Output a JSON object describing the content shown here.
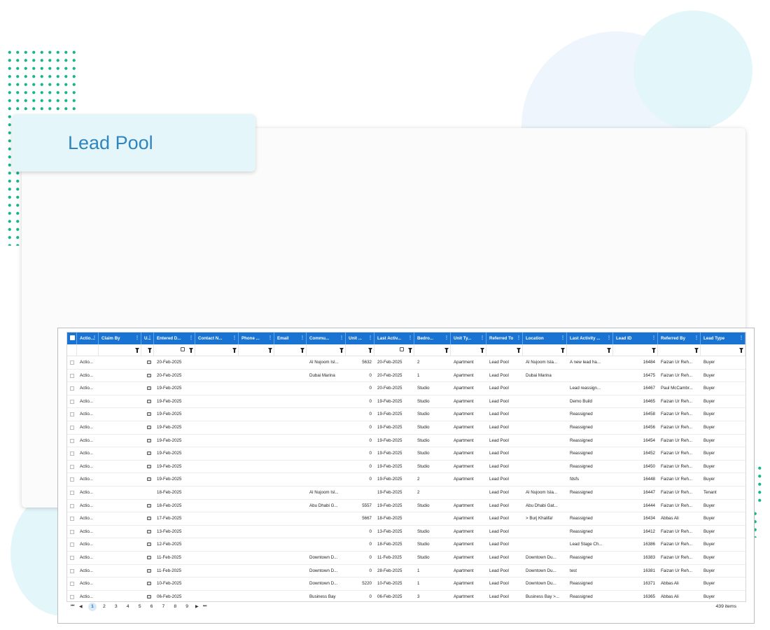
{
  "page": {
    "title": "Lead Pool"
  },
  "colors": {
    "accent": "#1873d3",
    "dots": "#16b58b",
    "title": "#2f86bf"
  },
  "columns": [
    {
      "key": "sel",
      "label": ""
    },
    {
      "key": "action",
      "label": "Actio..."
    },
    {
      "key": "claim_by",
      "label": "Claim By"
    },
    {
      "key": "u",
      "label": "U..."
    },
    {
      "key": "entered",
      "label": "Entered D..."
    },
    {
      "key": "contact",
      "label": "Contact N..."
    },
    {
      "key": "phone",
      "label": "Phone ..."
    },
    {
      "key": "email",
      "label": "Email"
    },
    {
      "key": "community",
      "label": "Commu..."
    },
    {
      "key": "unit",
      "label": "Unit ..."
    },
    {
      "key": "last_activity",
      "label": "Last Activ..."
    },
    {
      "key": "bedrooms",
      "label": "Bedro..."
    },
    {
      "key": "unit_type",
      "label": "Unit Ty..."
    },
    {
      "key": "referred_to",
      "label": "Referred To"
    },
    {
      "key": "location",
      "label": "Location"
    },
    {
      "key": "last_activity_note",
      "label": "Last Activity ..."
    },
    {
      "key": "lead_id",
      "label": "Lead ID"
    },
    {
      "key": "referred_by",
      "label": "Referred By"
    },
    {
      "key": "lead_type",
      "label": "Lead Type"
    }
  ],
  "rows": [
    {
      "action": "Actio...",
      "u": true,
      "entered": "20-Feb-2025",
      "community": "Al Nujoom Isl...",
      "unit": "5632",
      "last_activity": "20-Feb-2025",
      "bedrooms": "2",
      "unit_type": "Apartment",
      "referred_to": "Lead Pool",
      "location": "Al Nujoom Isla...",
      "note": "A new lead ha...",
      "lead_id": "16484",
      "referred_by": "Faizan Ur Reh...",
      "lead_type": "Buyer"
    },
    {
      "action": "Actio...",
      "u": true,
      "entered": "20-Feb-2025",
      "community": "Dubai Marina",
      "unit": "0",
      "last_activity": "20-Feb-2025",
      "bedrooms": "1",
      "unit_type": "Apartment",
      "referred_to": "Lead Pool",
      "location": "Dubai Marina",
      "note": "",
      "lead_id": "16475",
      "referred_by": "Faizan Ur Reh...",
      "lead_type": "Buyer"
    },
    {
      "action": "Actio...",
      "u": true,
      "entered": "19-Feb-2025",
      "community": "",
      "unit": "0",
      "last_activity": "20-Feb-2025",
      "bedrooms": "Studio",
      "unit_type": "Apartment",
      "referred_to": "Lead Pool",
      "location": "",
      "note": "Lead reassign...",
      "lead_id": "16467",
      "referred_by": "Paul McCambr...",
      "lead_type": "Buyer"
    },
    {
      "action": "Actio...",
      "u": true,
      "entered": "19-Feb-2025",
      "community": "",
      "unit": "0",
      "last_activity": "19-Feb-2025",
      "bedrooms": "Studio",
      "unit_type": "Apartment",
      "referred_to": "Lead Pool",
      "location": "",
      "note": "Demo Build",
      "lead_id": "16465",
      "referred_by": "Faizan Ur Reh...",
      "lead_type": "Buyer"
    },
    {
      "action": "Actio...",
      "u": true,
      "entered": "19-Feb-2025",
      "community": "",
      "unit": "0",
      "last_activity": "19-Feb-2025",
      "bedrooms": "Studio",
      "unit_type": "Apartment",
      "referred_to": "Lead Pool",
      "location": "",
      "note": "Reassigned",
      "lead_id": "16458",
      "referred_by": "Faizan Ur Reh...",
      "lead_type": "Buyer"
    },
    {
      "action": "Actio...",
      "u": true,
      "entered": "19-Feb-2025",
      "community": "",
      "unit": "0",
      "last_activity": "19-Feb-2025",
      "bedrooms": "Studio",
      "unit_type": "Apartment",
      "referred_to": "Lead Pool",
      "location": "",
      "note": "Reassigned",
      "lead_id": "16456",
      "referred_by": "Faizan Ur Reh...",
      "lead_type": "Buyer"
    },
    {
      "action": "Actio...",
      "u": true,
      "entered": "19-Feb-2025",
      "community": "",
      "unit": "0",
      "last_activity": "19-Feb-2025",
      "bedrooms": "Studio",
      "unit_type": "Apartment",
      "referred_to": "Lead Pool",
      "location": "",
      "note": "Reassigned",
      "lead_id": "16454",
      "referred_by": "Faizan Ur Reh...",
      "lead_type": "Buyer"
    },
    {
      "action": "Actio...",
      "u": true,
      "entered": "19-Feb-2025",
      "community": "",
      "unit": "0",
      "last_activity": "19-Feb-2025",
      "bedrooms": "Studio",
      "unit_type": "Apartment",
      "referred_to": "Lead Pool",
      "location": "",
      "note": "Reassigned",
      "lead_id": "16452",
      "referred_by": "Faizan Ur Reh...",
      "lead_type": "Buyer"
    },
    {
      "action": "Actio...",
      "u": true,
      "entered": "19-Feb-2025",
      "community": "",
      "unit": "0",
      "last_activity": "19-Feb-2025",
      "bedrooms": "Studio",
      "unit_type": "Apartment",
      "referred_to": "Lead Pool",
      "location": "",
      "note": "Reassigned",
      "lead_id": "16450",
      "referred_by": "Faizan Ur Reh...",
      "lead_type": "Buyer"
    },
    {
      "action": "Actio...",
      "u": true,
      "entered": "19-Feb-2025",
      "community": "",
      "unit": "0",
      "last_activity": "19-Feb-2025",
      "bedrooms": "2",
      "unit_type": "Apartment",
      "referred_to": "Lead Pool",
      "location": "",
      "note": "fdsfs",
      "lead_id": "16448",
      "referred_by": "Faizan Ur Reh...",
      "lead_type": "Buyer"
    },
    {
      "action": "Actio...",
      "u": false,
      "entered": "18-Feb-2025",
      "community": "Al Nujoom Isl...",
      "unit": "",
      "last_activity": "19-Feb-2025",
      "bedrooms": "2",
      "unit_type": "",
      "referred_to": "Lead Pool",
      "location": "Al Nujoom Isla...",
      "note": "Reassigned",
      "lead_id": "16447",
      "referred_by": "Faizan Ur Reh...",
      "lead_type": "Tenant"
    },
    {
      "action": "Actio...",
      "u": true,
      "entered": "18-Feb-2025",
      "community": "Abu Dhabi G...",
      "unit": "5557",
      "last_activity": "19-Feb-2025",
      "bedrooms": "Studio",
      "unit_type": "Apartment",
      "referred_to": "Lead Pool",
      "location": "Abu Dhabi Gat...",
      "note": "",
      "lead_id": "16444",
      "referred_by": "Faizan Ur Reh...",
      "lead_type": "Buyer"
    },
    {
      "action": "Actio...",
      "u": true,
      "entered": "17-Feb-2025",
      "community": "",
      "unit": "5667",
      "last_activity": "18-Feb-2025",
      "bedrooms": "",
      "unit_type": "Apartment",
      "referred_to": "Lead Pool",
      "location": "> Burj Khalifa!",
      "note": "Reassigned",
      "lead_id": "16434",
      "referred_by": "Abbas Ali",
      "lead_type": "Buyer"
    },
    {
      "action": "Actio...",
      "u": true,
      "entered": "13-Feb-2025",
      "community": "",
      "unit": "0",
      "last_activity": "13-Feb-2025",
      "bedrooms": "Studio",
      "unit_type": "Apartment",
      "referred_to": "Lead Pool",
      "location": "",
      "note": "Reassigned",
      "lead_id": "16412",
      "referred_by": "Faizan Ur Reh...",
      "lead_type": "Buyer"
    },
    {
      "action": "Actio...",
      "u": true,
      "entered": "12-Feb-2025",
      "community": "",
      "unit": "0",
      "last_activity": "18-Feb-2025",
      "bedrooms": "Studio",
      "unit_type": "Apartment",
      "referred_to": "Lead Pool",
      "location": "",
      "note": "Lead Stage Ch...",
      "lead_id": "16386",
      "referred_by": "Faizan Ur Reh...",
      "lead_type": "Buyer"
    },
    {
      "action": "Actio...",
      "u": true,
      "entered": "11-Feb-2025",
      "community": "Downtown D...",
      "unit": "0",
      "last_activity": "11-Feb-2025",
      "bedrooms": "Studio",
      "unit_type": "Apartment",
      "referred_to": "Lead Pool",
      "location": "Downtown Du...",
      "note": "Reassigned",
      "lead_id": "16383",
      "referred_by": "Faizan Ur Reh...",
      "lead_type": "Buyer"
    },
    {
      "action": "Actio...",
      "u": true,
      "entered": "11-Feb-2025",
      "community": "Downtown D...",
      "unit": "0",
      "last_activity": "28-Feb-2025",
      "bedrooms": "1",
      "unit_type": "Apartment",
      "referred_to": "Lead Pool",
      "location": "Downtown Du...",
      "note": "test",
      "lead_id": "16381",
      "referred_by": "Faizan Ur Reh...",
      "lead_type": "Buyer"
    },
    {
      "action": "Actio...",
      "u": true,
      "entered": "10-Feb-2025",
      "community": "Downtown D...",
      "unit": "5220",
      "last_activity": "10-Feb-2025",
      "bedrooms": "1",
      "unit_type": "Apartment",
      "referred_to": "Lead Pool",
      "location": "Downtown Du...",
      "note": "Reassigned",
      "lead_id": "16371",
      "referred_by": "Abbas Ali",
      "lead_type": "Buyer"
    },
    {
      "action": "Actio...",
      "u": true,
      "entered": "06-Feb-2025",
      "community": "Business Bay",
      "unit": "0",
      "last_activity": "06-Feb-2025",
      "bedrooms": "3",
      "unit_type": "Apartment",
      "referred_to": "Lead Pool",
      "location": "Business Bay >...",
      "note": "Reassigned",
      "lead_id": "16365",
      "referred_by": "Abbas Ali",
      "lead_type": "Buyer"
    }
  ],
  "pager": {
    "first": "⏮",
    "prev": "◀",
    "next": "▶",
    "last": "⏭",
    "pages": [
      "1",
      "2",
      "3",
      "4",
      "5",
      "6",
      "7",
      "8",
      "9"
    ],
    "current": "1",
    "items_text": "439 items"
  }
}
